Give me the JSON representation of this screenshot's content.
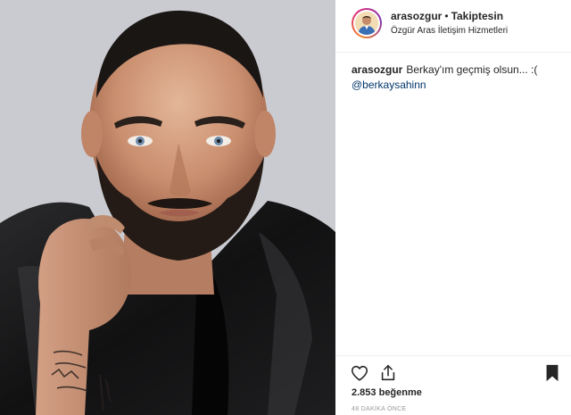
{
  "post": {
    "author": {
      "username": "arasozgur",
      "separator": "•",
      "follow_state": "Takiptesin",
      "subtitle": "Özgür Aras İletişim Hizmetleri"
    },
    "caption": {
      "username": "arasozgur",
      "text": "Berkay'ım geçmiş olsun... :(",
      "mention": "@berkaysahinn"
    },
    "likes": {
      "count": "2.853",
      "label": "beğenme"
    },
    "timestamp": "48 DAKİKA ÖNCE",
    "icons": {
      "like": "heart-outline-icon",
      "share": "share-upload-icon",
      "save": "bookmark-filled-icon"
    },
    "colors": {
      "text": "#262626",
      "link": "#003569",
      "muted": "#999999",
      "divider": "#efefef",
      "story_ring": [
        "#f58529",
        "#dd2a7b",
        "#8134af"
      ]
    }
  }
}
